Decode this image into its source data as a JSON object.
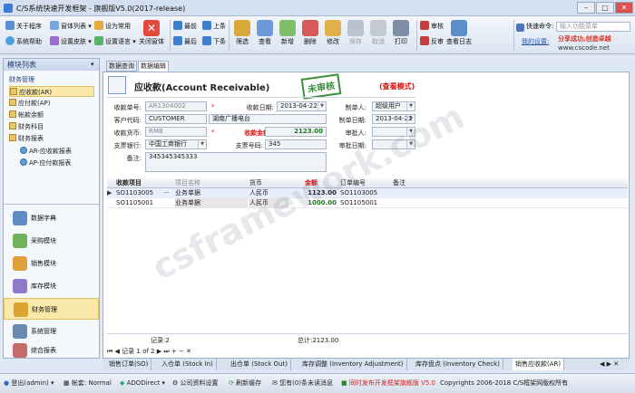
{
  "app": {
    "title": "C/S系统快速开发框架 - 旗舰版V5.0(2017-release)"
  },
  "window": {
    "minimize": "–",
    "maximize": "□",
    "close": "✕"
  },
  "ribbon": {
    "about": "关于程序",
    "window_list": "窗体列表",
    "set_default": "设为常用",
    "help": "系统帮助",
    "skin": "设置皮肤",
    "language": "设置语言",
    "close_window": "关闭窗体",
    "first": "最前",
    "prev": "上条",
    "last": "最后",
    "next": "下条",
    "tools": [
      "筛选",
      "查看",
      "新增",
      "删除",
      "修改",
      "保存",
      "取消",
      "打印"
    ],
    "approve": "审核",
    "reject": "反审",
    "audit_log": "查看日志",
    "quick_cmd_label": "快速命令:",
    "quick_cmd_placeholder": "输入功能菜单",
    "my_settings": "我的设置:",
    "brand1": "分享成功,创造卓越",
    "brand2": "www.cscode.net"
  },
  "left": {
    "header": "模块列表",
    "section": "财务管理",
    "tree": [
      "应收款(AR)",
      "应付款(AP)",
      "帐款余额",
      "财务科目",
      "财务报表"
    ],
    "subtree": [
      "AR-应收款报表",
      "AP-应付款报表"
    ],
    "modules": [
      "数据字典",
      "采购模块",
      "销售模块",
      "库存模块",
      "财务管理",
      "系统管理",
      "综合报表"
    ]
  },
  "tabs": {
    "query": "数据查询",
    "edit": "数据编辑"
  },
  "form": {
    "title": "应收款(Account Receivable)",
    "stamp": "未审核",
    "mode": "(查看模式)",
    "lbl_no": "收款单号:",
    "no": "AR1304002",
    "lbl_date": "收款日期:",
    "date": "2013-04-22",
    "lbl_maker": "制单人:",
    "maker": "超级用户",
    "lbl_cust": "客户代码:",
    "cust_code": "CUSTOMER",
    "cust_name": "湖南广播电台",
    "lbl_mdate": "制单日期:",
    "mdate": "2013-04-22",
    "lbl_cur": "收款货币:",
    "cur": "RMB",
    "lbl_amt": "收款金额:",
    "amt": "2123.00",
    "lbl_appr": "审批人:",
    "appr": "",
    "lbl_bank": "支票银行:",
    "bank": "中国工商银行",
    "lbl_chk": "支票号码:",
    "chk": "345",
    "lbl_adate": "审批日期:",
    "adate": "",
    "lbl_note": "备注:",
    "note": "345345345333"
  },
  "grid": {
    "headers": [
      "收款项目",
      "项目名称",
      "货币",
      "金额",
      "订单编号",
      "备注"
    ],
    "rows": [
      {
        "item": "SO1103005",
        "name": "业务单据",
        "cur": "人民币",
        "amt": "1123.00",
        "order": "SO1103005",
        "note": ""
      },
      {
        "item": "SO1105001",
        "name": "业务单据",
        "cur": "人民币",
        "amt": "1000.00",
        "order": "SO1105001",
        "note": ""
      }
    ],
    "count": "记录:2",
    "total": "总计:2123.00"
  },
  "nav": {
    "record": "记录 1 of 2"
  },
  "bottom_tabs": [
    "销售订单(SO)",
    "入仓单 (Stock In)",
    "出仓单 (Stock Out)",
    "库存调整 (Inventory Adjustment)",
    "库存盘点 (Inventory Check)",
    "销售应收款(AR)"
  ],
  "status": {
    "login": "登出(admin)",
    "account": "帐套: Normal",
    "db": "ADODirect",
    "company": "公司资料设置",
    "refresh": "刷新缓存",
    "msg": "您有(0)条未读消息",
    "notice": "同时发布开发框架旗舰版 V5.0",
    "copyright": "Copyrights 2006-2018 C/S框架网版权所有"
  },
  "watermark": "csframework.com"
}
